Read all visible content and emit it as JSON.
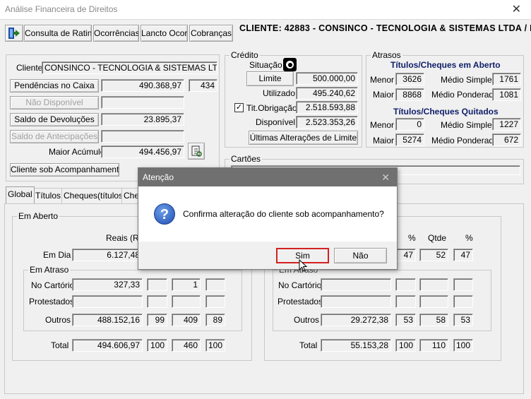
{
  "window": {
    "title": "Análise Financeira de Direitos",
    "close": "✕"
  },
  "toolbar": {
    "rating": "Consulta de Rating",
    "ocorrencias": "Ocorrências",
    "lancto": "Lancto Ocor.",
    "cobrancas": "Cobranças"
  },
  "header": {
    "cliente": "CLIENTE: 42883 - CONSINCO - TECNOLOGIA & SISTEMAS LTDA  / I"
  },
  "cliente": {
    "label": "Cliente",
    "name": "CONSINCO - TECNOLOGIA & SISTEMAS LTDA",
    "pendencias_label": "Pendências no Caixa",
    "pendencias_value": "490.368,97",
    "pendencias_count": "434",
    "nao_disponivel_label": "Não Disponível",
    "devolucoes_label": "Saldo de Devoluções",
    "devolucoes_value": "23.895,37",
    "antecipacoes_label": "Saldo de Antecipações",
    "maior_acumulo_label": "Maior Acúmulo",
    "maior_acumulo_value": "494.456,97",
    "acompanhamento_label": "Cliente sob Acompanhamento"
  },
  "credito": {
    "title": "Crédito",
    "situacao_label": "Situação",
    "limite_label": "Limite",
    "limite_value": "500.000,00",
    "utilizado_label": "Utilizado",
    "utilizado_value": "495.240,62",
    "tit_obrigacao_label": "Tit.Obrigação",
    "tit_obrigacao_value": "2.518.593,88",
    "tit_obrigacao_checked": "✓",
    "disponivel_label": "Disponível",
    "disponivel_value": "2.523.353,26",
    "ultimas_label": "Últimas Alterações de Limite"
  },
  "atrasos": {
    "title": "Atrasos",
    "aberto_header": "Títulos/Cheques em Aberto",
    "aberto_menor_label": "Menor",
    "aberto_menor": "3626",
    "aberto_medio_simples_label": "Médio Simples",
    "aberto_medio_simples": "1761",
    "aberto_maior_label": "Maior",
    "aberto_maior": "8868",
    "aberto_medio_ponderado_label": "Médio Ponderado",
    "aberto_medio_ponderado": "1081",
    "quitados_header": "Títulos/Cheques Quitados",
    "quitados_menor_label": "Menor",
    "quitados_menor": "0",
    "quitados_medio_simples_label": "Médio Simples",
    "quitados_medio_simples": "1227",
    "quitados_maior_label": "Maior",
    "quitados_maior": "5274",
    "quitados_medio_ponderado_label": "Médio Ponderado",
    "quitados_medio_ponderado": "672"
  },
  "cartoes": {
    "title": "Cartões"
  },
  "tabs": [
    "Global",
    "Títulos",
    "Cheques(títulos)",
    "Che"
  ],
  "left_panel": {
    "em_aberto": "Em Aberto",
    "reais_header": "Reais (R$",
    "em_dia_label": "Em Dia",
    "em_dia_value": "6.127,48",
    "em_atraso": "Em Atraso",
    "no_cartorio_label": "No Cartório",
    "no_cartorio_value": "327,33",
    "no_cartorio_qtde": "1",
    "protestados_label": "Protestados",
    "outros_label": "Outros",
    "outros_value": "488.152,16",
    "outros_pct": "99",
    "outros_qtde": "409",
    "outros_pct2": "89",
    "total_label": "Total",
    "total_value": "494.606,97",
    "total_pct": "100",
    "total_qtde": "460",
    "total_pct2": "100"
  },
  "right_panel": {
    "pct_header": "%",
    "qtde_header": "Qtde",
    "pct2_header": "%",
    "em_dia_pct": "47",
    "em_dia_qtde": "52",
    "em_dia_pct2": "47",
    "em_atraso_partial": "Em Atraso",
    "no_cartorio_label": "No Cartório",
    "protestados_label": "Protestados",
    "outros_label": "Outros",
    "outros_value": "29.272,38",
    "outros_pct": "53",
    "outros_qtde": "58",
    "outros_pct2": "53",
    "total_label": "Total",
    "total_value": "55.153,28",
    "total_pct": "100",
    "total_qtde": "110",
    "total_pct2": "100"
  },
  "dialog": {
    "title": "Atenção",
    "close": "✕",
    "message": "Confirma alteração do cliente sob acompanhamento?",
    "yes": "Sim",
    "no": "Não",
    "icon": "question-icon"
  }
}
